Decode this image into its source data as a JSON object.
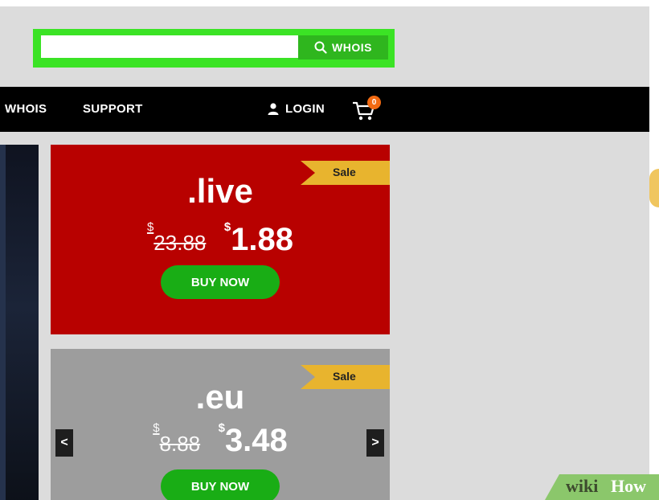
{
  "search": {
    "placeholder": "",
    "value": "",
    "button_label": "WHOIS"
  },
  "nav": {
    "items": [
      {
        "label": "WHOIS"
      },
      {
        "label": "SUPPORT"
      }
    ],
    "login_label": "LOGIN",
    "cart_count": "0"
  },
  "cards": [
    {
      "tld": ".live",
      "currency": "$",
      "old_price": "23.88",
      "new_price": "1.88",
      "badge": "Sale",
      "button": "BUY NOW",
      "background": "#b80100"
    },
    {
      "tld": ".eu",
      "currency": "$",
      "old_price": "8.88",
      "new_price": "3.48",
      "badge": "Sale",
      "button": "BUY NOW",
      "background": "#9d9d9d"
    }
  ],
  "carousel": {
    "prev": "<",
    "next": ">"
  },
  "watermark": {
    "part1": "wiki",
    "part2": "How"
  },
  "colors": {
    "search_border": "#3be325",
    "search_button": "#2fb61e",
    "buy_button": "#19ad15",
    "sale_ribbon": "#e8b42e",
    "cart_badge": "#f26a12"
  }
}
